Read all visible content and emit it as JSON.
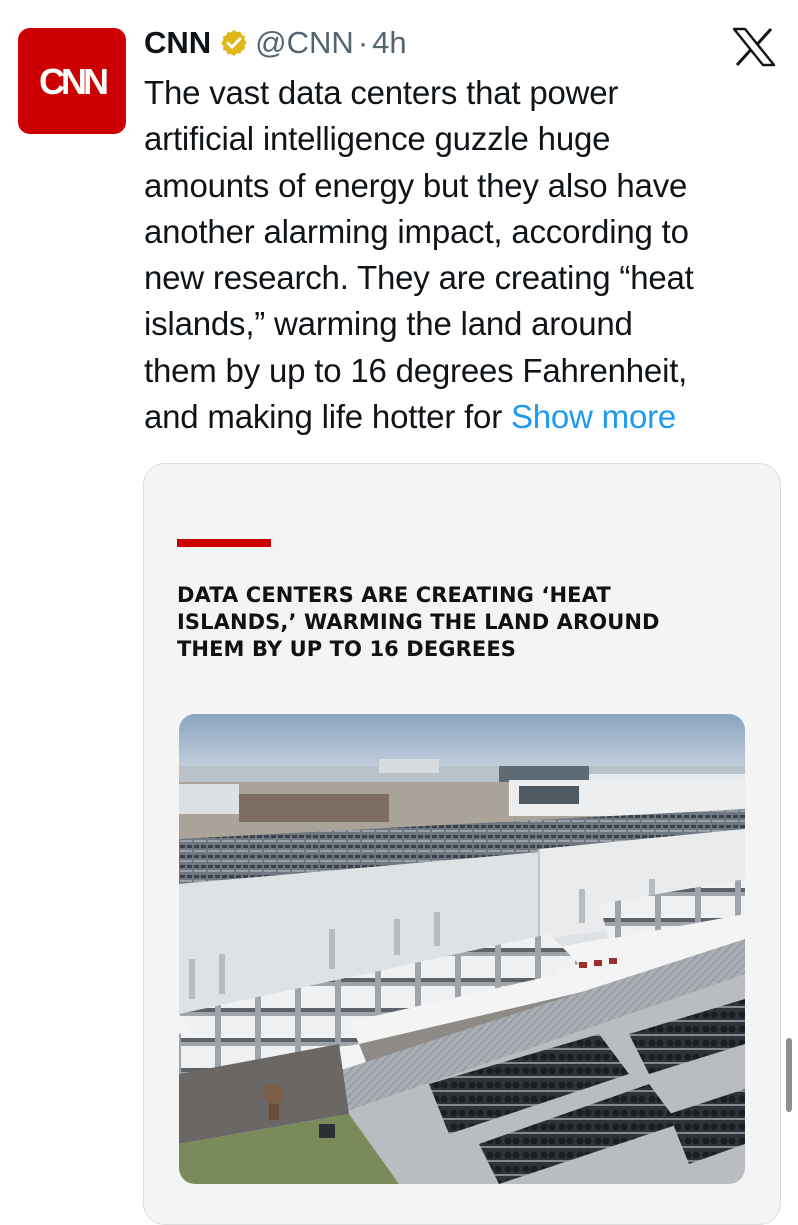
{
  "tweet": {
    "author_name": "CNN",
    "handle": "@CNN",
    "separator": "·",
    "time": "4h",
    "avatar_text": "CNN",
    "text_lines": [
      "The vast data centers that power",
      "artificial intelligence guzzle huge",
      "amounts of energy but they also have",
      "another alarming impact, according to",
      "new research. They are creating “heat",
      "islands,” warming the land around",
      "them by up to 16 degrees Fahrenheit,",
      "and making life hotter for"
    ],
    "show_more": "Show more"
  },
  "card": {
    "headline_lines": [
      "DATA CENTERS ARE CREATING ‘HEAT",
      "ISLANDS,’ WARMING THE LAND AROUND",
      "THEM BY UP TO 16 DEGREES"
    ]
  },
  "icons": {
    "verified": "verified-badge-icon",
    "platform": "x-logo-icon"
  },
  "colors": {
    "brand_red": "#cc0000",
    "link_blue": "#1d9bf0",
    "verified_gold": "#e2b719",
    "secondary_text": "#536471"
  }
}
